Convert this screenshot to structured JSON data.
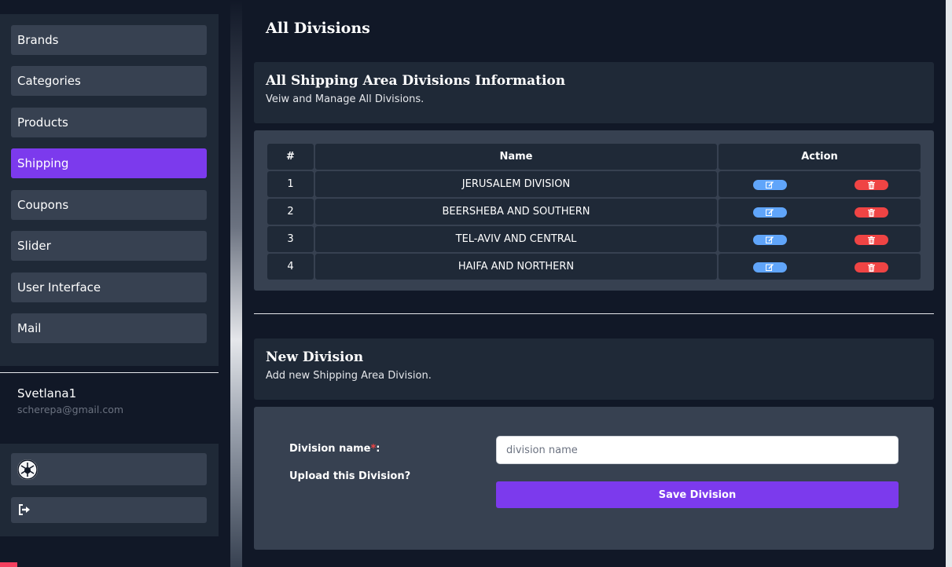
{
  "sidebar": {
    "nav_items": [
      "Brands",
      "Categories",
      "Products",
      "Shipping",
      "Coupons",
      "Slider",
      "User Interface",
      "Mail"
    ],
    "active_item": "Shipping",
    "user": {
      "name": "Svetlana1",
      "email": "scherepa@gmail.com"
    },
    "icons": {
      "avatar": "avatar-icon",
      "logout": "logout-icon"
    }
  },
  "main": {
    "page_title": "All Divisions",
    "list_card": {
      "title": "All Shipping Area Divisions Information",
      "subtitle": "Veiw and Manage All Divisions."
    },
    "table": {
      "headers": [
        "#",
        "Name",
        "Action"
      ],
      "rows": [
        {
          "num": "1",
          "name": "JERUSALEM DIVISION"
        },
        {
          "num": "2",
          "name": "BEERSHEBA AND SOUTHERN"
        },
        {
          "num": "3",
          "name": "TEL-AVIV AND CENTRAL"
        },
        {
          "num": "4",
          "name": "HAIFA AND NORTHERN"
        }
      ],
      "action_icons": [
        "edit-icon",
        "trash-icon"
      ]
    },
    "form_card": {
      "title": "New Division",
      "subtitle": "Add new Shipping Area Division."
    },
    "form": {
      "division_label": "Division name",
      "required_mark": "*",
      "division_label_suffix": ":",
      "division_placeholder": "division name",
      "division_value": "",
      "upload_label": "Upload this Division?",
      "save_label": "Save Division"
    }
  },
  "colors": {
    "accent": "#7c3aed",
    "edit": "#60a5fa",
    "delete": "#ef4444"
  }
}
